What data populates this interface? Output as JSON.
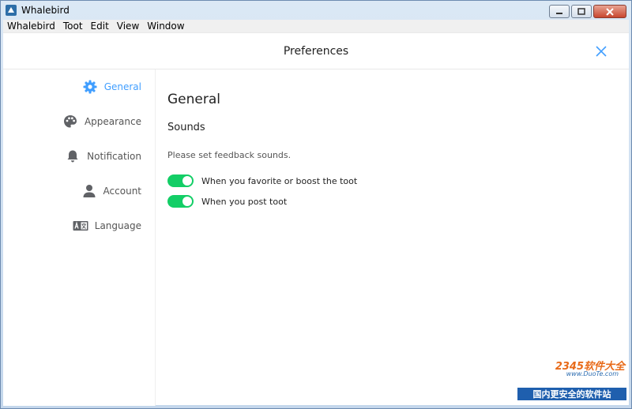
{
  "window": {
    "title": "Whalebird"
  },
  "menu": [
    "Whalebird",
    "Toot",
    "Edit",
    "View",
    "Window"
  ],
  "header": {
    "title": "Preferences"
  },
  "sidebar": {
    "items": [
      {
        "label": "General",
        "icon": "gear-icon",
        "active": true
      },
      {
        "label": "Appearance",
        "icon": "palette-icon",
        "active": false
      },
      {
        "label": "Notification",
        "icon": "bell-icon",
        "active": false
      },
      {
        "label": "Account",
        "icon": "user-icon",
        "active": false
      },
      {
        "label": "Language",
        "icon": "language-icon",
        "active": false
      }
    ]
  },
  "main": {
    "title": "General",
    "section": "Sounds",
    "description": "Please set feedback sounds.",
    "toggles": [
      {
        "label": "When you favorite or boost the toot",
        "on": true
      },
      {
        "label": "When you post toot",
        "on": true
      }
    ]
  },
  "watermark": {
    "logo": "2345软件大全",
    "url": "www.DuoTe.com",
    "banner": "国内更安全的软件站"
  },
  "colors": {
    "accent": "#409eff",
    "switch_on": "#13ce66"
  }
}
